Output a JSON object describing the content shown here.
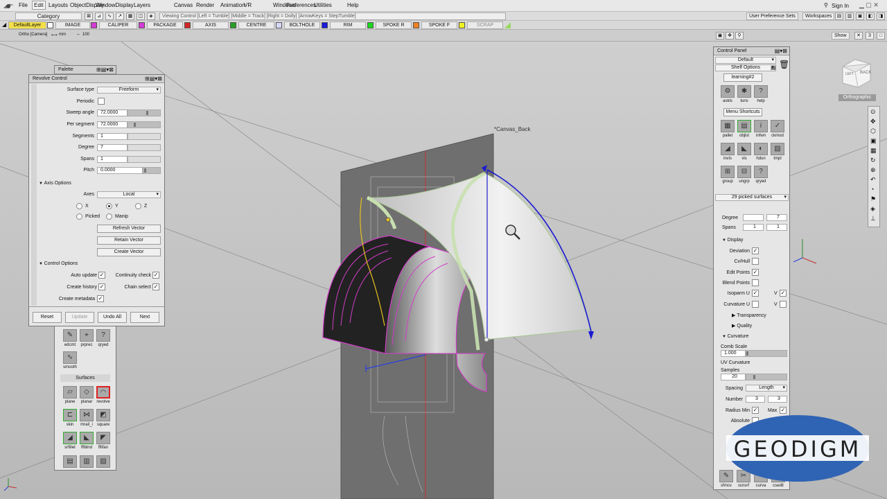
{
  "menu": {
    "logo_label": "revolv",
    "items": [
      "File",
      "Edit",
      "Layouts",
      "ObjectDisplay",
      "WindowDisplay",
      "Layers",
      "Canvas",
      "Render",
      "Animation",
      "VR",
      "Windows",
      "Preferences",
      "Utilities",
      "Help"
    ],
    "active": "Edit",
    "signin": "Sign In"
  },
  "toolbar2": {
    "category": "Category",
    "viewing_control": "Viewing Control   [Left = Tumble]   [Middle = Track]   [Right = Dolly]   [ArrowKeys = StepTumble]",
    "user_pref": "User Preference Sets",
    "workspaces": "Workspaces"
  },
  "layers": [
    {
      "name": "DefaultLayer",
      "color": "#f3e04a"
    },
    {
      "name": "IMAGE",
      "color": "#d43ad4"
    },
    {
      "name": "CALIPER",
      "color": "#d42424"
    },
    {
      "name": "PACKAGE",
      "color": "#24a0d4"
    },
    {
      "name": "AXIS",
      "color": "#24a024"
    },
    {
      "name": "CENTRE",
      "color": "#d8d8ff"
    },
    {
      "name": "BOLTHOLE",
      "color": "#1a1ad8"
    },
    {
      "name": "RIM",
      "color": "#1ad81a"
    },
    {
      "name": "SPOKE R",
      "color": "#f08020"
    },
    {
      "name": "SPOKE F",
      "color": "#f0f020"
    },
    {
      "name": "SCRAP",
      "color": "#9ad860"
    }
  ],
  "statusbar": {
    "camera": "Ortho [Camera]",
    "units": "mm",
    "zoom": "100",
    "show": "Show"
  },
  "viewport": {
    "canvas_label": "*Canvas_Back",
    "cube_left": "LEFT",
    "cube_back": "BACK",
    "projection": "Orthographic"
  },
  "palette": {
    "title": "Palette",
    "items_top": [
      {
        "label": "edcmt",
        "icon": "edit-cmt-icon"
      },
      {
        "label": "prprec",
        "icon": "precision-icon"
      },
      {
        "label": "qryed",
        "icon": "query-edit-icon"
      },
      {
        "label": "smooth",
        "icon": "smooth-icon"
      }
    ],
    "section": "Surfaces",
    "items": [
      {
        "label": "plane"
      },
      {
        "label": "planar"
      },
      {
        "label": "revolve"
      },
      {
        "label": "skin"
      },
      {
        "label": "mrail_i"
      },
      {
        "label": "square"
      },
      {
        "label": "srfillet"
      },
      {
        "label": "fflblnd"
      },
      {
        "label": "ffilfan"
      }
    ]
  },
  "revolve": {
    "title": "Revolve Control",
    "surface_type_label": "Surface type",
    "surface_type": "Freeform",
    "periodic_label": "Periodic",
    "sweep_label": "Sweep angle",
    "sweep": "72.0000",
    "per_segment_label": "Per segment",
    "per_segment": "72.0000",
    "segments_label": "Segments",
    "segments": "1",
    "degree_label": "Degree",
    "degree": "7",
    "spans_label": "Spans",
    "spans": "1",
    "pitch_label": "Pitch",
    "pitch": "0.0000",
    "axis_section": "Axis Options",
    "axes_label": "Axes",
    "axes": "Local",
    "x": "X",
    "y": "Y",
    "z": "Z",
    "picked": "Picked",
    "manip": "Manip",
    "refresh": "Refresh Vector",
    "retain": "Retain Vector",
    "create": "Create Vector",
    "control_section": "Control Options",
    "auto_update": "Auto update",
    "continuity": "Continuity check",
    "create_history": "Create history",
    "chain_select": "Chain select",
    "create_metadata": "Create metadata",
    "reset": "Reset",
    "update": "Update",
    "undo_all": "Undo All",
    "next": "Next"
  },
  "control_panel": {
    "title": "Control Panel",
    "preset": "Default",
    "shelf_options": "Shelf Options",
    "tab": "learning#2",
    "shelf": [
      {
        "label": "askls"
      },
      {
        "label": "tuns"
      },
      {
        "label": "help"
      }
    ],
    "menu_shortcuts": "Menu Shortcuts",
    "shortcuts": [
      {
        "label": "pallet"
      },
      {
        "label": "objlst"
      },
      {
        "label": "infwn"
      },
      {
        "label": "ckmod"
      },
      {
        "label": "invis"
      },
      {
        "label": "vis"
      },
      {
        "label": "hdun"
      },
      {
        "label": "tmpl"
      },
      {
        "label": "group"
      },
      {
        "label": "ungrp"
      },
      {
        "label": "qryed"
      }
    ],
    "picked": "29 picked surfaces",
    "degree_label": "Degree",
    "degree_u": "",
    "degree_v": "7",
    "spans_label": "Spans",
    "spans_u": "1",
    "spans_v": "1",
    "display": "Display",
    "deviation": "Deviation",
    "cvhull": "Cv/Hull",
    "edit_points": "Edit Points",
    "blend_points": "Blend Points",
    "isoparm_u": "Isoparm U",
    "v": "V",
    "curvature_u": "Curvature U",
    "transparency": "Transparency",
    "quality": "Quality",
    "curvature": "Curvature",
    "comb_scale": "Comb Scale",
    "comb_scale_val": "1.000",
    "uv_curvature": "UV Curvature",
    "samples": "Samples",
    "samples_val": "20",
    "spacing": "Spacing",
    "spacing_val": "Length",
    "number": "Number",
    "number_u": "3",
    "number_v": "3",
    "radius_min": "Radius Min",
    "max": "Max",
    "absolute": "Absolute",
    "bottom_icons": [
      {
        "label": "sfmcv"
      },
      {
        "label": "scnsrf"
      },
      {
        "label": "curva"
      },
      {
        "label": "csedit"
      }
    ]
  },
  "watermark": "GEODIGM"
}
